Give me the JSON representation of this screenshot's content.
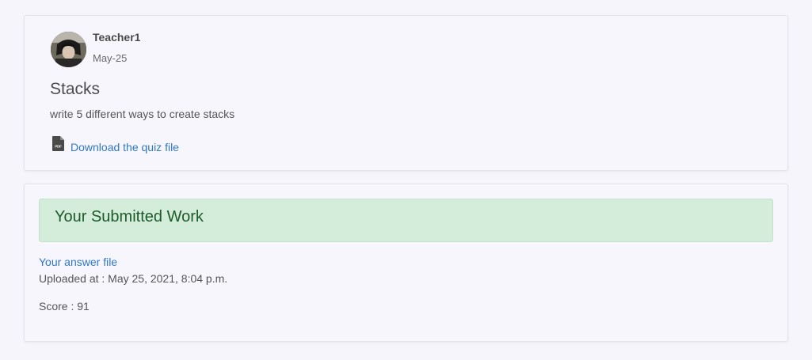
{
  "post": {
    "author": "Teacher1",
    "date": "May-25",
    "title": "Stacks",
    "description": "write 5 different ways to create stacks",
    "file_icon": "pdf-file-icon",
    "file_icon_text": "PDF",
    "download_label": "Download the quiz file"
  },
  "submission": {
    "heading": "Your Submitted Work",
    "answer_link_label": "Your answer file",
    "uploaded_at": "Uploaded at : May 25, 2021, 8:04 p.m.",
    "score": "Score : 91"
  },
  "colors": {
    "link": "#2f78c4",
    "success_bg": "#d4ecda",
    "success_text": "#1d5b2a",
    "page_bg": "#f7f5fc"
  }
}
